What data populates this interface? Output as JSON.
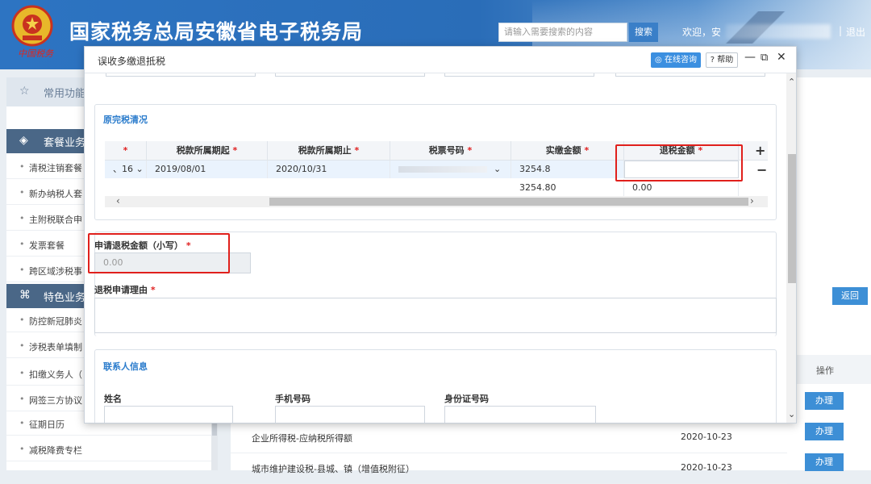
{
  "header": {
    "site_title": "国家税务总局安徽省电子税务局",
    "slogan": "中国税务",
    "search_placeholder": "请输入需要搜索的内容",
    "search_label": "搜索",
    "welcome": "欢迎，安",
    "separator": "|",
    "logout": "退出"
  },
  "sidebar": {
    "section_common": "常用功能",
    "section_package": "套餐业务",
    "package_items": [
      "清税注销套餐",
      "新办纳税人套",
      "主附税联合申",
      "发票套餐",
      "跨区域涉税事"
    ],
    "section_special": "特色业务",
    "special_items": [
      "防控新冠肺炎",
      "涉税表单填制",
      "扣缴义务人（",
      "网签三方协议",
      "征期日历",
      "减税降费专栏"
    ]
  },
  "main": {
    "back_label": "返回",
    "ops_header": "操作",
    "do_label": "办理",
    "rows": [
      {
        "name": "企业所得税-应纳税所得额",
        "date": "2020-10-23"
      },
      {
        "name": "城市维护建设税-县城、镇（增值税附征）",
        "date": "2020-10-23"
      }
    ]
  },
  "modal": {
    "title": "误收多缴退抵税",
    "consult_label": "在线咨询",
    "help_label": "帮助",
    "original_section_title": "原完税清况",
    "table": {
      "headers": {
        "period_start": "税款所属期起",
        "period_end": "税款所属期止",
        "ticket_no": "税票号码",
        "paid": "实缴金额",
        "refund": "退税金额"
      },
      "required_mark": "*",
      "row": {
        "sel": "、16",
        "period_start": "2019/08/01",
        "period_end": "2020/10/31",
        "paid": "3254.8",
        "refund": ""
      },
      "total": {
        "paid": "3254.80",
        "refund": "0.00"
      }
    },
    "apply_label": "申请退税金额（小写）",
    "apply_value": "0.00",
    "reason_label": "退税申请理由",
    "contact_section_title": "联系人信息",
    "contact_fields": {
      "name": "姓名",
      "phone": "手机号码",
      "id": "身份证号码"
    }
  },
  "colors": {
    "brand_blue": "#2d74c2",
    "highlight_red": "#e0201c",
    "section_title": "#2b7ccc"
  }
}
